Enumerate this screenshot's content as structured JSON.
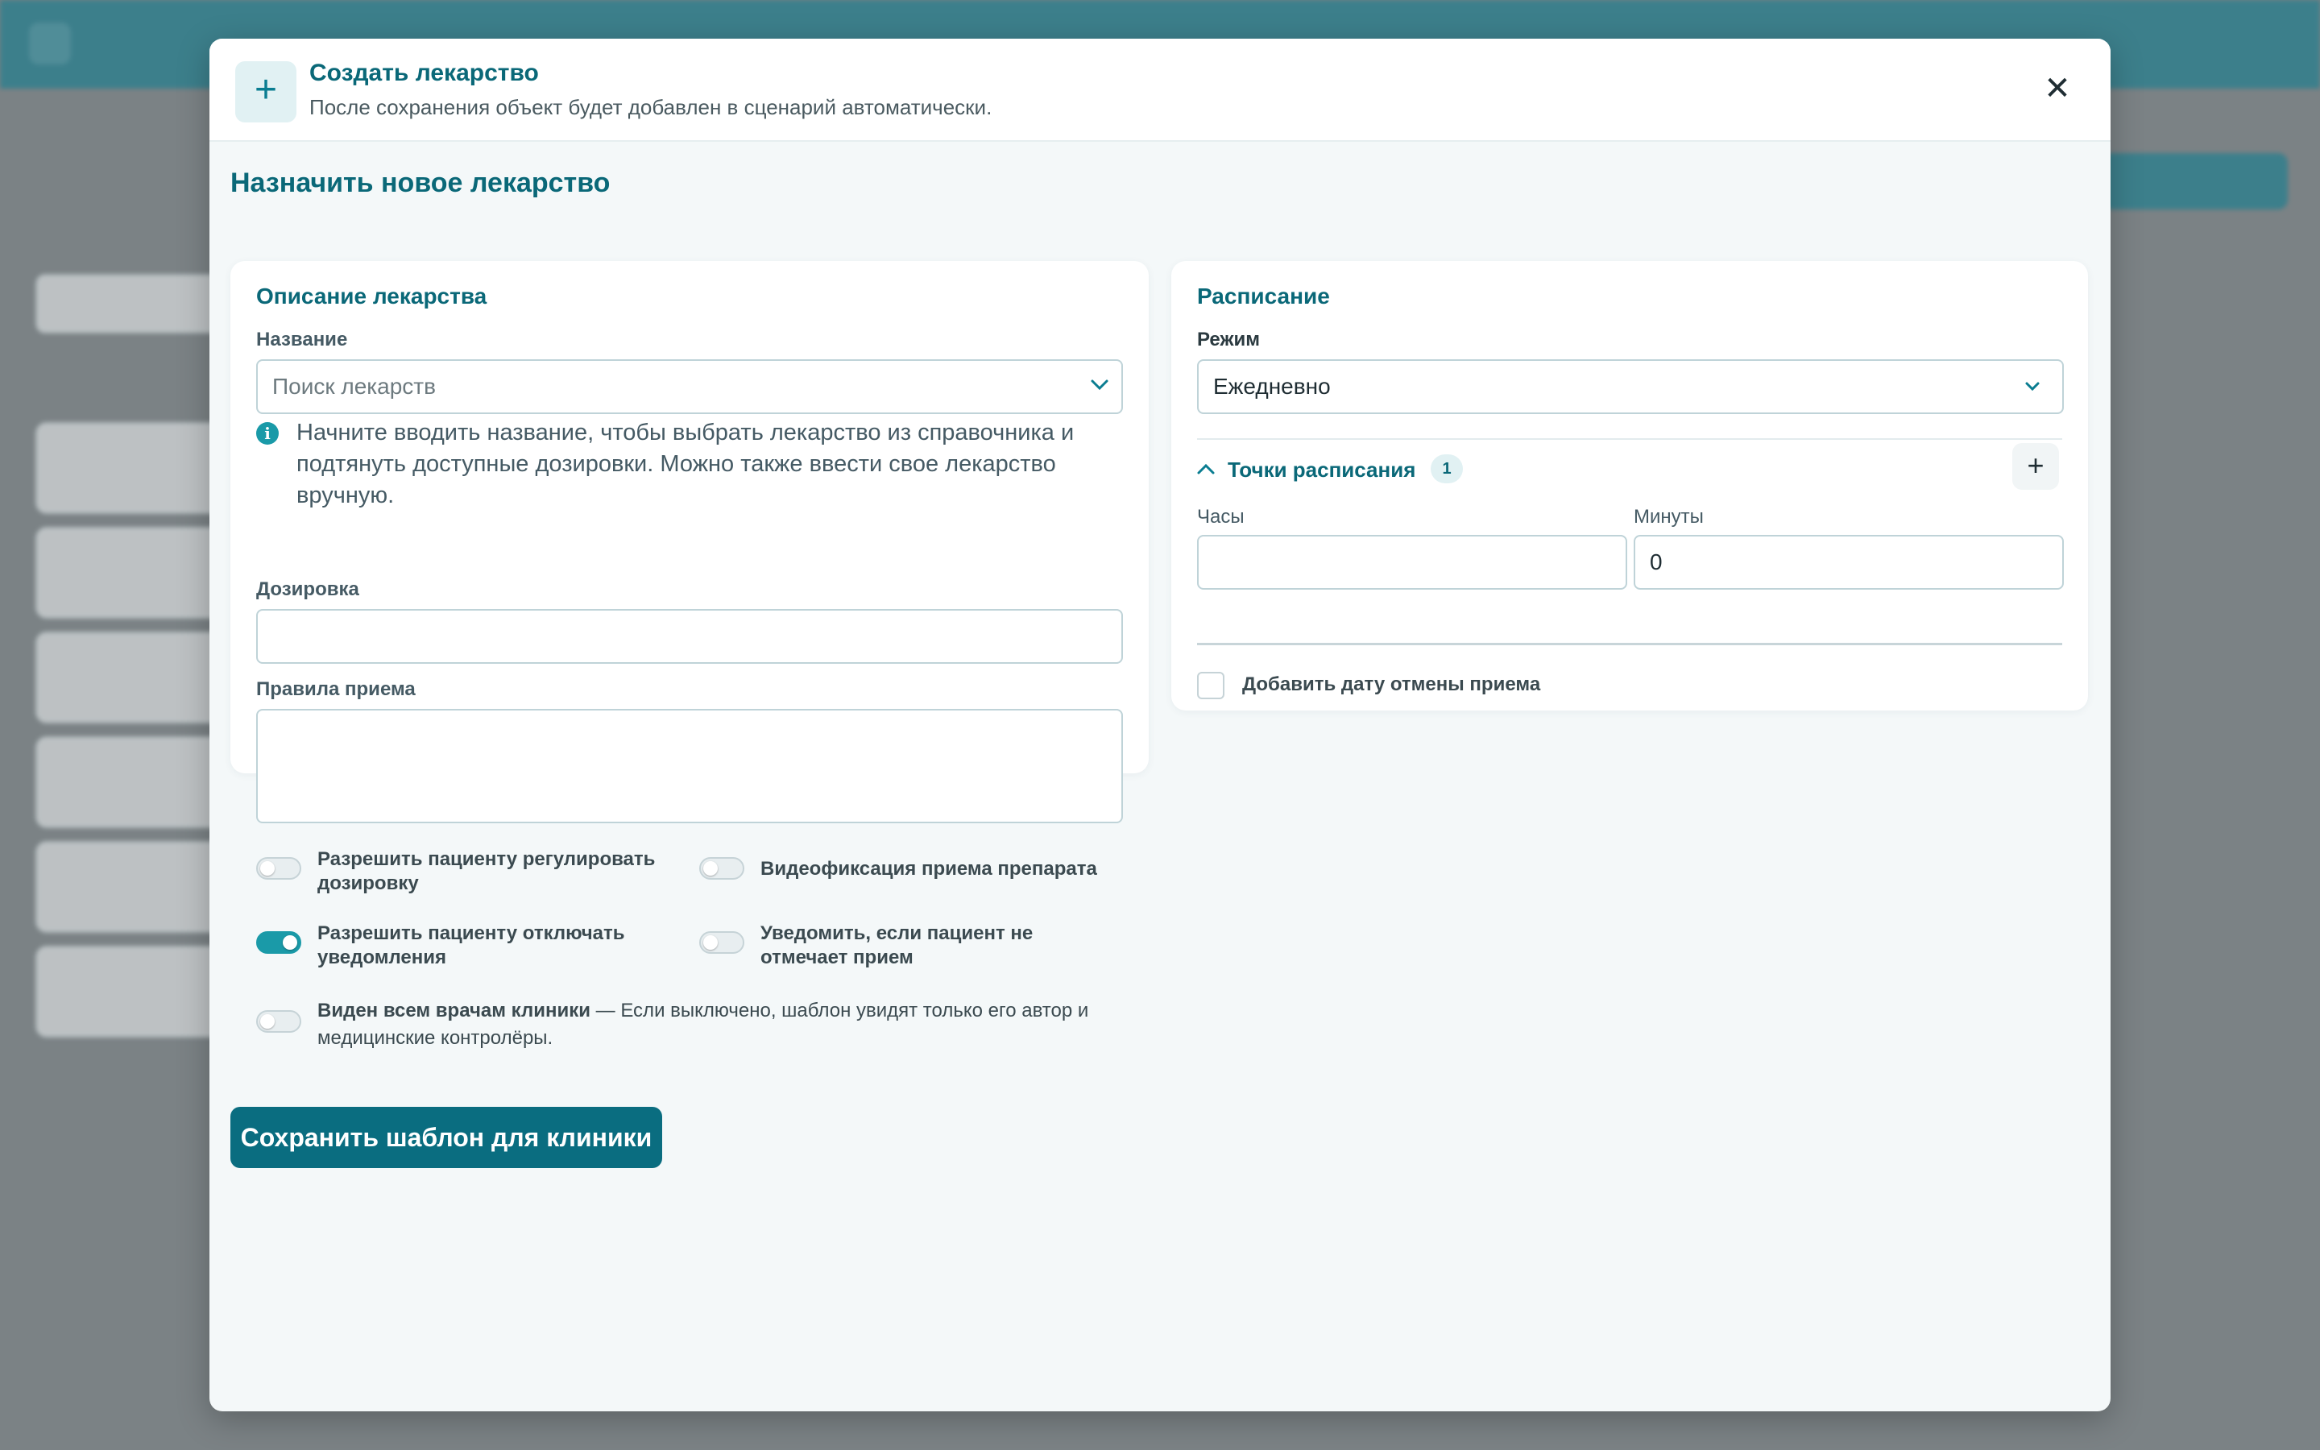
{
  "modal": {
    "header_icon": "plus-icon",
    "title": "Создать лекарство",
    "subtitle": "После сохранения объект будет добавлен в сценарий автоматически.",
    "close_symbol": "✕",
    "page_heading": "Назначить новое лекарство"
  },
  "description": {
    "title": "Описание лекарства",
    "name_label": "Название",
    "name_placeholder": "Поиск лекарств",
    "hint": "Начните вводить название, чтобы выбрать лекарство из справочника и подтянуть доступные дозировки. Можно также ввести свое лекарство вручную.",
    "dosage_label": "Дозировка",
    "dosage_value": "",
    "rules_label": "Правила приема",
    "rules_value": "",
    "toggles": [
      {
        "label": "Разрешить пациенту регулировать дозировку",
        "on": false
      },
      {
        "label": "Видеофиксация приема препарата",
        "on": false
      },
      {
        "label": "Разрешить пациенту отключать уведомления",
        "on": true
      },
      {
        "label": "Уведомить, если пациент не отмечает прием",
        "on": false
      }
    ],
    "visibility_title": "Виден всем врачам клиники",
    "visibility_desc": " — Если выключено, шаблон увидят только его автор и медицинские контролёры.",
    "visibility_on": false
  },
  "schedule": {
    "title": "Расписание",
    "mode_label": "Режим",
    "mode_value": "Ежедневно",
    "points_label": "Точки расписания",
    "points_count": "1",
    "hours_label": "Часы",
    "hours_value": "",
    "minutes_label": "Минуты",
    "minutes_value": "0",
    "cancel_date_label": "Добавить дату отмены приема"
  },
  "actions": {
    "save_clinic_label": "Сохранить шаблон для клиники"
  },
  "colors": {
    "accent": "#0a7d91",
    "dark_accent": "#0a6d80",
    "toggle_on": "#1a9aa8"
  }
}
